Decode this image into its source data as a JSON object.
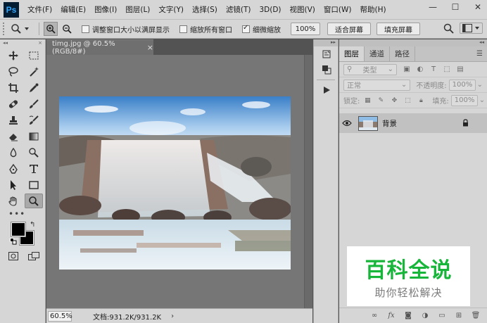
{
  "app": {
    "logo": "Ps"
  },
  "menu": [
    "文件(F)",
    "编辑(E)",
    "图像(I)",
    "图层(L)",
    "文字(Y)",
    "选择(S)",
    "滤镜(T)",
    "3D(D)",
    "视图(V)",
    "窗口(W)",
    "帮助(H)"
  ],
  "window_controls": {
    "minimize": "—",
    "maximize": "☐",
    "close": "✕"
  },
  "options": {
    "resize_windows": {
      "label": "调整窗口大小以满屏显示",
      "checked": false
    },
    "zoom_all_windows": {
      "label": "缩放所有窗口",
      "checked": false
    },
    "scrubby_zoom": {
      "label": "细微缩放",
      "checked": true
    },
    "zoom_100_label": "100%",
    "fit_screen_label": "适合屏幕",
    "fill_screen_label": "填充屏幕"
  },
  "document": {
    "tab_title": "timg.jpg @ 60.5%(RGB/8#)",
    "close_glyph": "×",
    "zoom": "60.5%",
    "doc_info": "文档:931.2K/931.2K",
    "status_arrow": "›"
  },
  "layers_panel": {
    "tabs": [
      "图层",
      "通道",
      "路径"
    ],
    "active_tab": "图层",
    "filter_label": "类型",
    "blend_mode": "正常",
    "opacity_label": "不透明度:",
    "opacity_value": "100%",
    "lock_label": "锁定:",
    "fill_label": "填充:",
    "fill_value": "100%",
    "layers": [
      {
        "name": "背景",
        "visible": true,
        "locked": true
      }
    ]
  },
  "watermark": {
    "title": "百科全说",
    "subtitle": "助你轻松解决"
  },
  "colors": {
    "accent": "#31a8ff",
    "chrome": "#d6d6d6",
    "workspace": "#535353",
    "watermark_green": "#17b63a"
  }
}
